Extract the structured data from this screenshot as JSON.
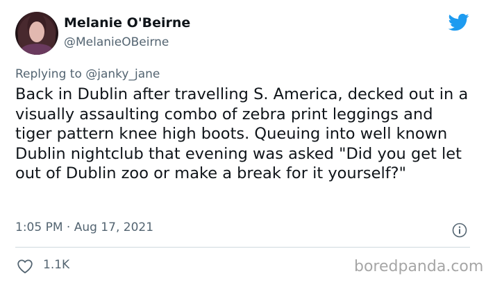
{
  "author": {
    "display_name": "Melanie O'Beirne",
    "handle": "@MelanieOBeirne"
  },
  "reply_to": {
    "prefix": "Replying to",
    "mention": "@janky_jane"
  },
  "tweet": {
    "text": "Back in Dublin after travelling S. America, decked out in a visually assaulting combo of zebra print leggings and tiger pattern knee high boots. Queuing into well known Dublin nightclub that evening was asked \"Did you get let out of Dublin zoo or make a break for it yourself?\"",
    "timestamp": "1:05 PM · Aug 17, 2021"
  },
  "engagement": {
    "likes": "1.1K"
  },
  "watermark": "boredpanda.com",
  "icons": {
    "brand": "twitter-bird-icon",
    "info": "info-icon",
    "like": "heart-icon"
  },
  "colors": {
    "twitter_blue": "#1d9bf0",
    "secondary_text": "#536471",
    "primary_text": "#0f1419",
    "divider": "#cfd9de",
    "watermark": "#a6a6a6"
  }
}
